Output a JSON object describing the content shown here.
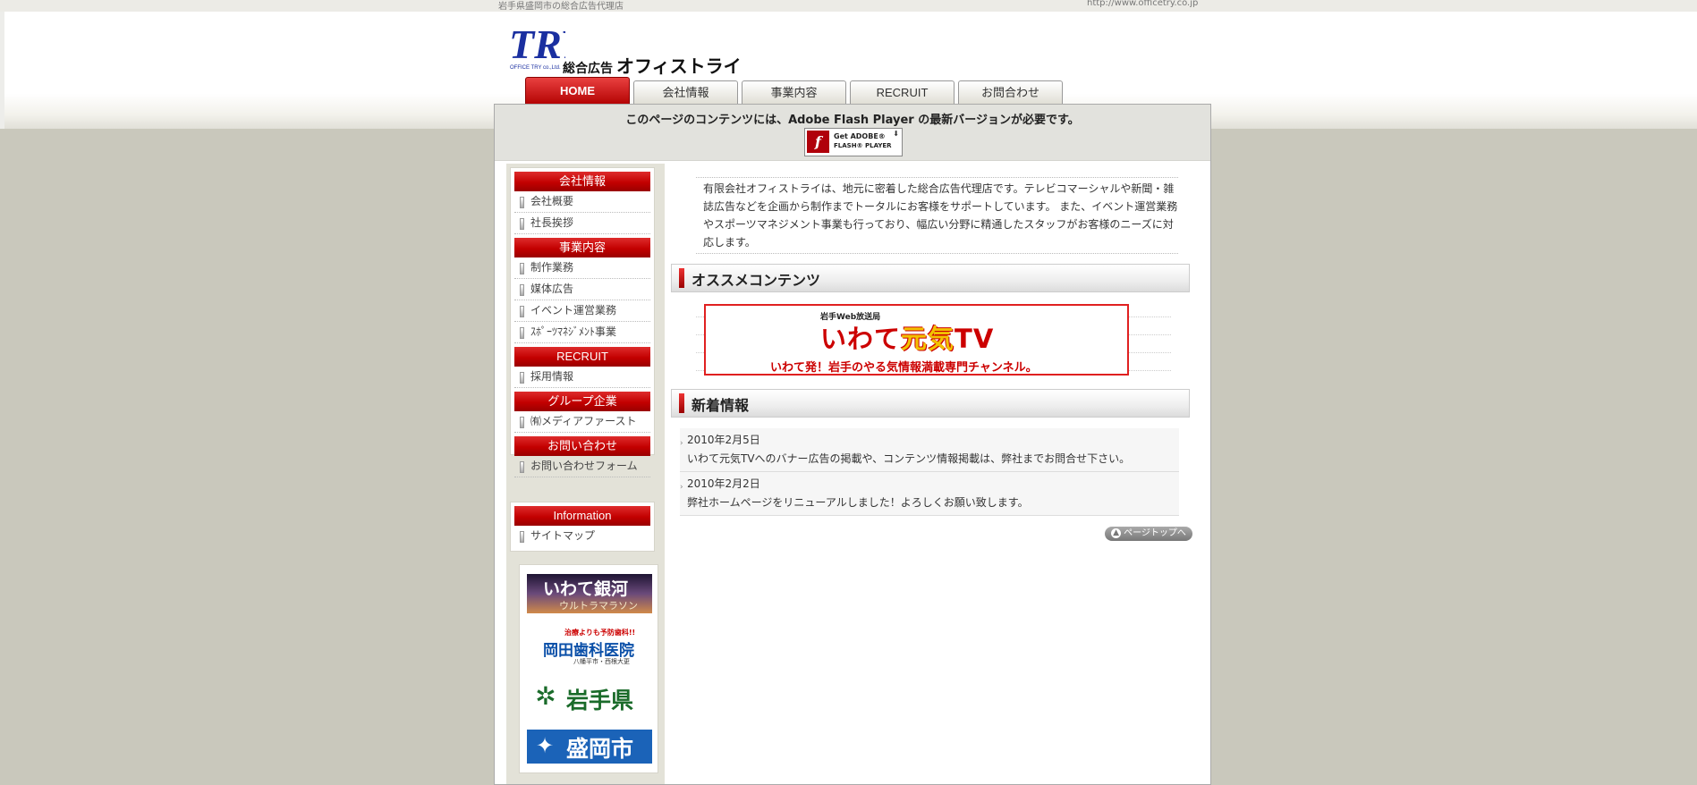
{
  "topbar": {
    "tagline": "岩手県盛岡市の総合広告代理店",
    "url": "http://www.officetry.co.jp"
  },
  "logo": {
    "mark": "TRY",
    "mark_sub": "OFFICE TRY co.,Ltd.",
    "label_small": "総合広告",
    "label_big": "オフィストライ"
  },
  "tabs": [
    {
      "label": "HOME",
      "active": true
    },
    {
      "label": "会社情報"
    },
    {
      "label": "事業内容"
    },
    {
      "label": "RECRUIT"
    },
    {
      "label": "お問合わせ"
    }
  ],
  "flash": {
    "message": "このページのコンテンツには、Adobe Flash Player の最新バージョンが必要です。",
    "badge_line1": "Get ADOBE®",
    "badge_line2": "FLASH® PLAYER"
  },
  "sidebar": {
    "groups": [
      {
        "heading": "会社情報",
        "items": [
          "会社概要",
          "社長挨拶"
        ]
      },
      {
        "heading": "事業内容",
        "items": [
          "制作業務",
          "媒体広告",
          "イベント運営業務",
          "ｽﾎﾟｰﾂﾏﾈｼﾞﾒﾝﾄ事業"
        ]
      },
      {
        "heading": "RECRUIT",
        "items": [
          "採用情報"
        ]
      },
      {
        "heading": "グループ企業",
        "items": [
          "㈲メディアファースト"
        ]
      },
      {
        "heading": "お問い合わせ",
        "items": [
          "お問い合わせフォーム"
        ]
      }
    ],
    "info": {
      "heading": "Information",
      "items": [
        "サイトマップ"
      ]
    },
    "banners": {
      "b1_title": "いわて銀河",
      "b1_sub": "ウルトラマラソン",
      "b2_top": "治療よりも予防歯科!!",
      "b2_name": "岡田歯科医院",
      "b2_addr": "八幡平市・西根大更",
      "b3_name": "岩手県",
      "b4_name": "盛岡市"
    }
  },
  "main": {
    "intro": "有限会社オフィストライは、地元に密着した総合広告代理店です。テレビコマーシャルや新聞・雑誌広告などを企画から制作までトータルにお客様をサポートしています。 また、イベント運営業務やスポーツマネジメント事業も行っており、幅広い分野に精通したスタッフがお客様のニーズに対応します。",
    "recommend_heading": "オススメコンテンツ",
    "tv_banner": {
      "small": "岩手Web放送局",
      "main_a": "いわて",
      "main_b": "元気",
      "main_c": "TV",
      "sub": "いわて発！岩手のやる気情報満載専門チャンネル。"
    },
    "news_heading": "新着情報",
    "news": [
      {
        "date": "2010年2月5日",
        "text": "いわて元気TVへのバナー広告の掲載や、コンテンツ情報掲載は、弊社までお問合せ下さい。"
      },
      {
        "date": "2010年2月2日",
        "text": "弊社ホームページをリニューアルしました！よろしくお願い致します。"
      }
    ],
    "pagetop": "ページトップへ"
  },
  "colors": {
    "accent_red": "#c30000",
    "logo_blue": "#1a2fa0",
    "sidebar_bg": "#e3e2d8",
    "page_bg": "#c9c8bc"
  }
}
